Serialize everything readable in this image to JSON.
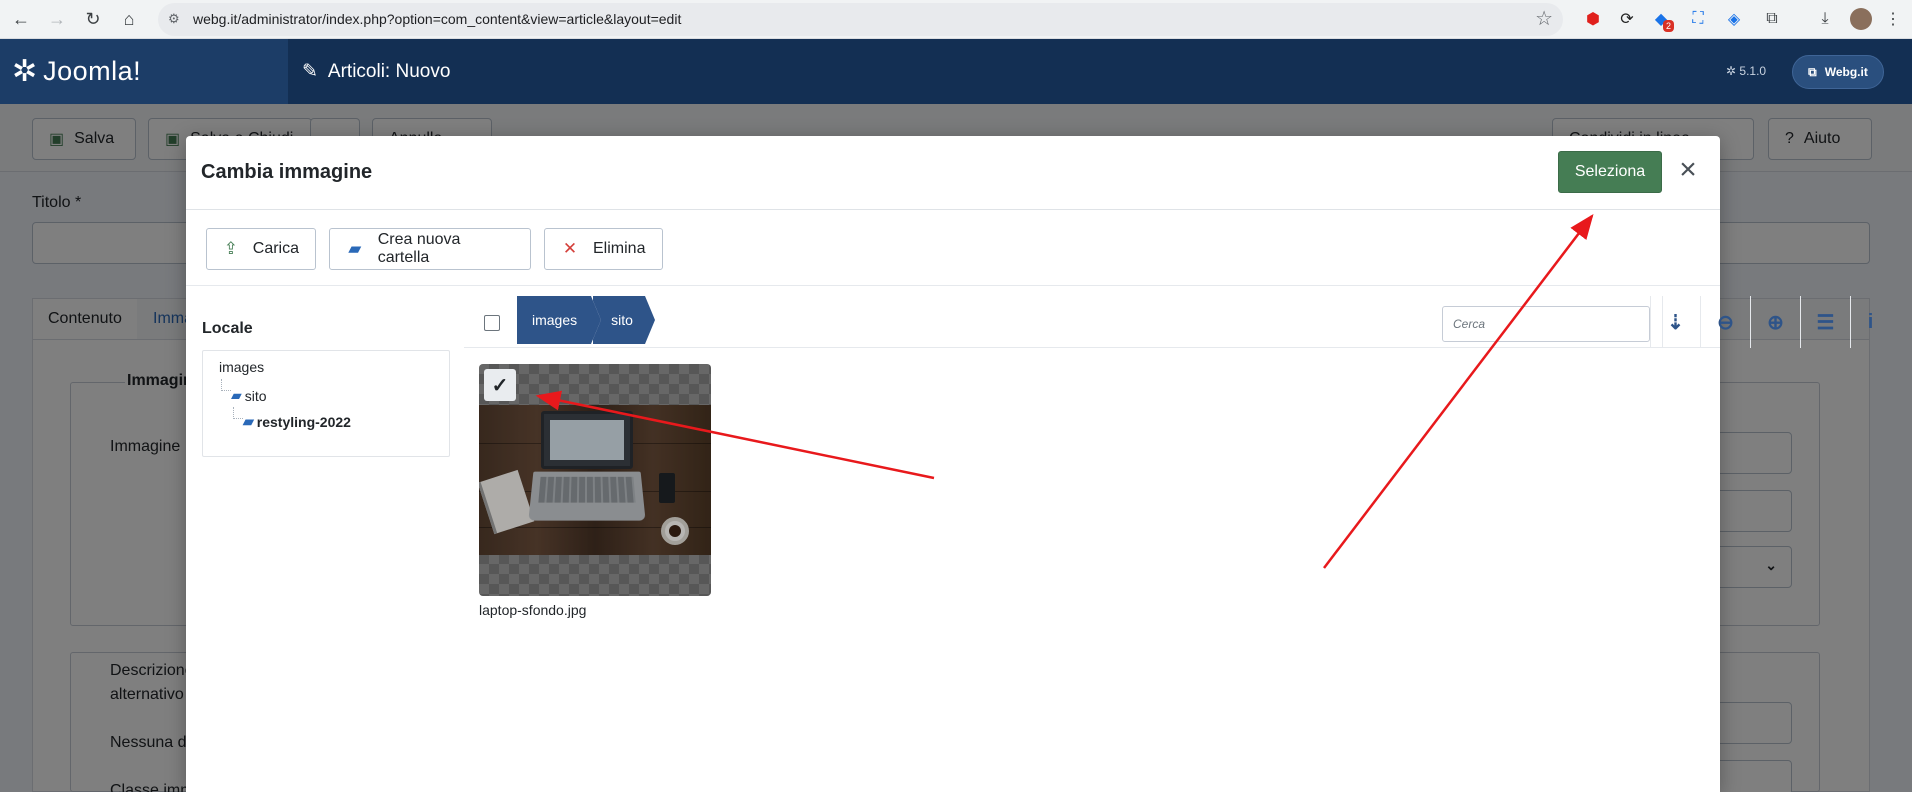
{
  "browser": {
    "url": "webg.it/administrator/index.php?option=com_content&view=article&layout=edit",
    "extension_badge": "2"
  },
  "header": {
    "logo_text": "Joomla!",
    "title": "Articoli: Nuovo",
    "version": "5.1.0",
    "site_button": "Webg.it"
  },
  "background": {
    "toolbar": {
      "save": "Salva",
      "save_close": "Salva e Chiudi",
      "cancel": "Annulla",
      "versions": "Condividi in linea",
      "help": "Aiuto"
    },
    "title_label": "Titolo *",
    "tabs": [
      "Contenuto",
      "Immagini e link"
    ],
    "fieldset_legend": "Immagini",
    "label_image": "Immagine",
    "label_alt_1": "Descrizione",
    "label_alt_2": "alternativo",
    "label_none": "Nessuna d",
    "label_class": "Classe imm"
  },
  "modal": {
    "title": "Cambia immagine",
    "select_button": "Seleziona",
    "tools": {
      "upload": "Carica",
      "new_folder": "Crea nuova cartella",
      "delete": "Elimina"
    },
    "sidebar": {
      "title": "Locale",
      "tree": [
        {
          "label": "images",
          "level": 0
        },
        {
          "label": "sito",
          "level": 1
        },
        {
          "label": "restyling-2022",
          "level": 2
        }
      ]
    },
    "breadcrumbs": [
      "images",
      "sito"
    ],
    "search_placeholder": "Cerca",
    "files": [
      {
        "name": "laptop-sfondo.jpg",
        "selected": true
      }
    ]
  },
  "colors": {
    "header_bg": "#132f53",
    "accent_green": "#457d54",
    "crumb_blue": "#2e5489",
    "annotation_red": "#e8191c"
  }
}
